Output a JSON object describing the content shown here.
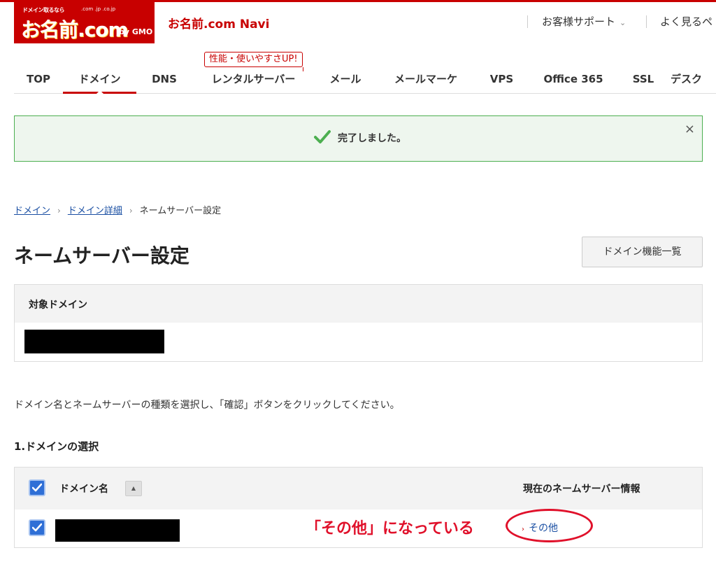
{
  "header": {
    "logo_small_text": "ドメイン取るなら",
    "logo_domains": ".com  .jp  .co.jp",
    "logo_main": "お名前.com",
    "logo_by": "by GMO",
    "site_title": "お名前.com Navi",
    "support_label": "お客様サポート",
    "faq_label": "よく見るペ"
  },
  "promo_tag": "性能・使いやすさUP!",
  "nav": {
    "items": [
      {
        "label": "TOP"
      },
      {
        "label": "ドメイン"
      },
      {
        "label": "DNS"
      },
      {
        "label": "レンタルサーバー"
      },
      {
        "label": "メール"
      },
      {
        "label": "メールマーケ"
      },
      {
        "label": "VPS"
      },
      {
        "label": "Office 365"
      },
      {
        "label": "SSL"
      },
      {
        "label": "デスク"
      }
    ],
    "active_index": 1
  },
  "alert": {
    "message": "完了しました。",
    "close_symbol": "×",
    "color": "#4caf50"
  },
  "breadcrumb": {
    "items": [
      "ドメイン",
      "ドメイン詳細",
      "ネームサーバー設定"
    ]
  },
  "page": {
    "title": "ネームサーバー設定",
    "feature_list_button": "ドメイン機能一覧",
    "target_domain_label": "対象ドメイン",
    "instruction": "ドメイン名とネームサーバーの種類を選択し、「確認」ボタンをクリックしてください。",
    "section_title": "1.ドメインの選択"
  },
  "domain_table": {
    "col_domain": "ドメイン名",
    "col_nameserver": "現在のネームサーバー情報",
    "rows": [
      {
        "nameserver_link": "その他",
        "checked": true
      }
    ]
  },
  "annotation": {
    "text": "「その他」になっている",
    "color": "#e0102a"
  },
  "colors": {
    "brand": "#c80000",
    "link": "#1a4fa3",
    "checkbox": "#2f6fd6"
  }
}
